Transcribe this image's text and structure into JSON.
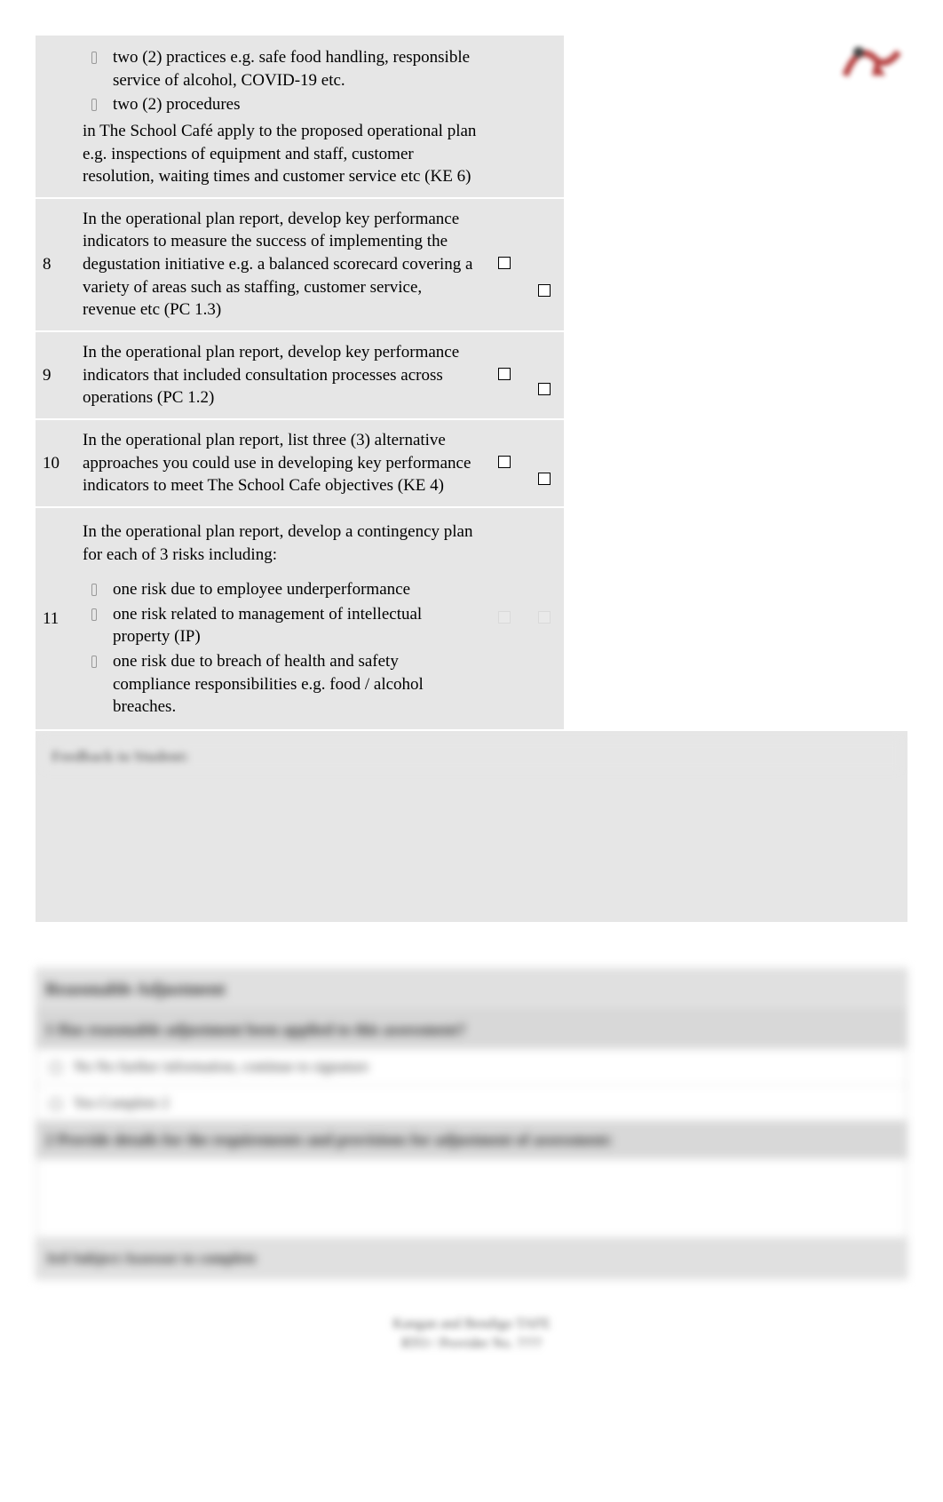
{
  "rows": [
    {
      "num": "",
      "bullets": [
        "two (2) practices e.g. safe food handling, responsible service of alcohol, COVID-19 etc.",
        "two (2) procedures"
      ],
      "tail": "in The School Café apply to the proposed operational plan e.g. inspections of equipment and staff, customer resolution, waiting times and customer service etc (KE 6)",
      "chk1": "",
      "chk2": ""
    },
    {
      "num": "8",
      "desc": "In the operational plan report, develop key performance indicators to measure the success of implementing the degustation initiative e.g. a balanced scorecard covering a variety of areas such as staffing, customer service, revenue etc (PC 1.3)",
      "chk1": "☐",
      "chk2": "☐"
    },
    {
      "num": "9",
      "desc": "In the operational plan report, develop key performance indicators that included consultation processes across operations (PC 1.2)",
      "chk1": "☐",
      "chk2": "☐"
    },
    {
      "num": "10",
      "desc": "In the operational plan report, list three (3) alternative approaches you could use in developing key performance indicators to meet The School Cafe objectives (KE 4)",
      "chk1": "☐",
      "chk2": "☐"
    },
    {
      "num": "11",
      "intro": "In the operational plan report, develop a contingency plan for each of 3 risks including:",
      "bullets": [
        "one risk due to employee underperformance",
        "one risk related to management of intellectual property (IP)",
        "one risk due to breach of health and safety compliance responsibilities e.g. food / alcohol breaches."
      ],
      "chk1": "☐",
      "chk2": "☐",
      "faded": true
    }
  ],
  "feedback_label": "Feedback to Student:",
  "ra": {
    "title": "Reasonable Adjustment",
    "q1": "1    Has reasonable adjustment been applied to this assessment?",
    "opt_no": "No        No further information, continue to signature",
    "opt_yes": "Yes       Complete 2",
    "q2": "2    Provide details for the requirements and provisions for adjustment of assessment:",
    "footer": "3rd Subject Assessor to complete"
  },
  "bottom": {
    "line1": "Kangan and Bendigo TAFE",
    "line2": "RTO / Provider No. ????"
  }
}
